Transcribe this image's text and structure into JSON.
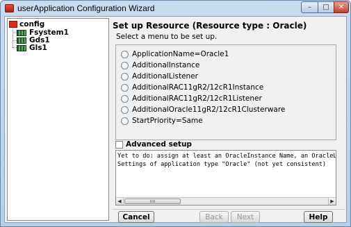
{
  "window": {
    "title": "userApplication Configuration Wizard",
    "controls": [
      "minimize-icon",
      "maximize-icon",
      "close-icon"
    ]
  },
  "tree": {
    "root": {
      "label": "config",
      "icon": "config-node-icon"
    },
    "children": [
      {
        "label": "Fsystem1",
        "icon": "resource-node-icon"
      },
      {
        "label": "Gds1",
        "icon": "resource-node-icon"
      },
      {
        "label": "Gls1",
        "icon": "resource-node-icon"
      }
    ]
  },
  "main": {
    "heading": "Set up Resource (Resource type : Oracle)",
    "subtitle": "Select a menu to be set up.",
    "options": [
      "ApplicationName=Oracle1",
      "AdditionalInstance",
      "AdditionalListener",
      "AdditionalRAC11gR2/12cR1Instance",
      "AdditionalRAC11gR2/12cR1Listener",
      "AdditionalOracle11gR2/12cR1Clusterware",
      "StartPriority=Same"
    ],
    "advanced_label": "Advanced setup",
    "log_lines": [
      "Yet to do: assign at least an OracleInstance Name, an OracleListener",
      "Settings of application type \"Oracle\" (not yet consistent)"
    ]
  },
  "buttons": {
    "cancel": "Cancel",
    "back": "Back",
    "next": "Next",
    "help": "Help"
  }
}
